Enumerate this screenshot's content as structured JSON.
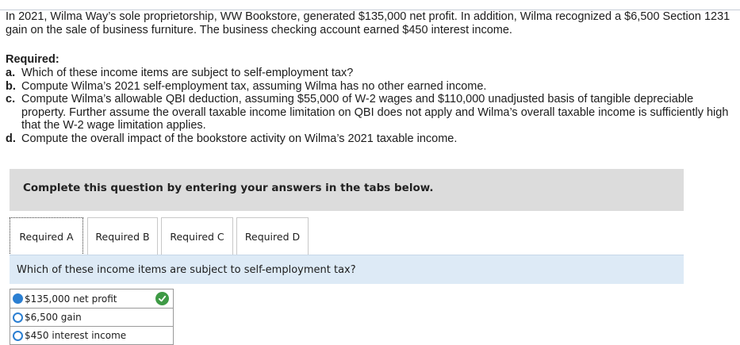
{
  "intro": "In 2021, Wilma Way’s sole proprietorship, WW Bookstore, generated $135,000 net profit. In addition, Wilma recognized a $6,500 Section 1231 gain on the sale of business furniture. The business checking account earned $450 interest income.",
  "required_heading": "Required:",
  "requirements": [
    {
      "label": "a.",
      "text": "Which of these income items are subject to self-employment tax?"
    },
    {
      "label": "b.",
      "text": "Compute Wilma’s 2021 self-employment tax, assuming Wilma has no other earned income."
    },
    {
      "label": "c.",
      "text": "Compute Wilma’s allowable QBI deduction, assuming $55,000 of W-2 wages and $110,000 unadjusted basis of tangible depreciable property. Further assume the overall taxable income limitation on QBI does not apply and Wilma’s overall taxable income is sufficiently high that the W-2 wage limitation applies."
    },
    {
      "label": "d.",
      "text": "Compute the overall impact of the bookstore activity on Wilma’s 2021 taxable income."
    }
  ],
  "instruction": "Complete this question by entering your answers in the tabs below.",
  "tabs": [
    {
      "label": "Required A",
      "active": true
    },
    {
      "label": "Required B",
      "active": false
    },
    {
      "label": "Required C",
      "active": false
    },
    {
      "label": "Required D",
      "active": false
    }
  ],
  "question": "Which of these income items are subject to self-employment tax?",
  "options": [
    {
      "label": "$135,000 net profit",
      "selected": true
    },
    {
      "label": "$6,500 gain",
      "selected": false
    },
    {
      "label": "$450 interest income",
      "selected": false
    }
  ],
  "answer_status_icon": "check-circle-icon",
  "colors": {
    "accent": "#2b7fd2",
    "correct": "#3e9a45",
    "question_bg": "#ddeaf6",
    "instruction_bg": "#dcdcdc"
  }
}
